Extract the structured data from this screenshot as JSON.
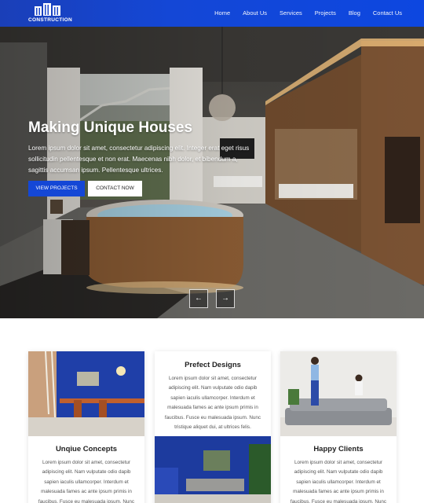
{
  "header": {
    "logo_text": "CONSTRUCTION",
    "nav": [
      "Home",
      "About Us",
      "Services",
      "Projects",
      "Blog",
      "Contact Us"
    ]
  },
  "hero": {
    "title": "Making Unique Houses",
    "text": "Lorem ipsum dolor sit amet, consectetur adipiscing elit. Integer erat eget risus sollicitudin pellentesque et non erat. Maecenas nibh dolor, et bibendum a, sagittis accumsan ipsum. Pellentesque ultrices.",
    "primary_button": "VIEW PROJECTS",
    "secondary_button": "CONTACT NOW",
    "prev_icon": "←",
    "next_icon": "→"
  },
  "cards": [
    {
      "title": "Unqiue Concepts",
      "text": "Lorem ipsum dolor sit amet, consectetur adipiscing elit. Nam vulputate odio dapib sapien iaculis ullamcorper. Interdum et malesuada fames ac ante ipsum primis in faucibus. Fusce eu malesuada ipsum. Nunc"
    },
    {
      "title": "Prefect Designs",
      "text": "Lorem ipsum dolor sit amet, consectetur adipiscing elit. Nam vulputate odio dapib sapien iaculis ullamcorper. Interdum et malesuada fames ac ante ipsum primis in faucibus. Fusce eu malesuada ipsum. Nunc tristique aliquet dui, at ultrices felis."
    },
    {
      "title": "Happy Clients",
      "text": "Lorem ipsum dolor sit amet, consectetur adipiscing elit. Nam vulputate odio dapib sapien iaculis ullamcorper. Interdum et malesuada fames ac ante ipsum primis in faucibus. Fusce eu malesuada ipsum. Nunc"
    }
  ],
  "colors": {
    "brand_blue": "#1447d6",
    "text": "#333333"
  }
}
